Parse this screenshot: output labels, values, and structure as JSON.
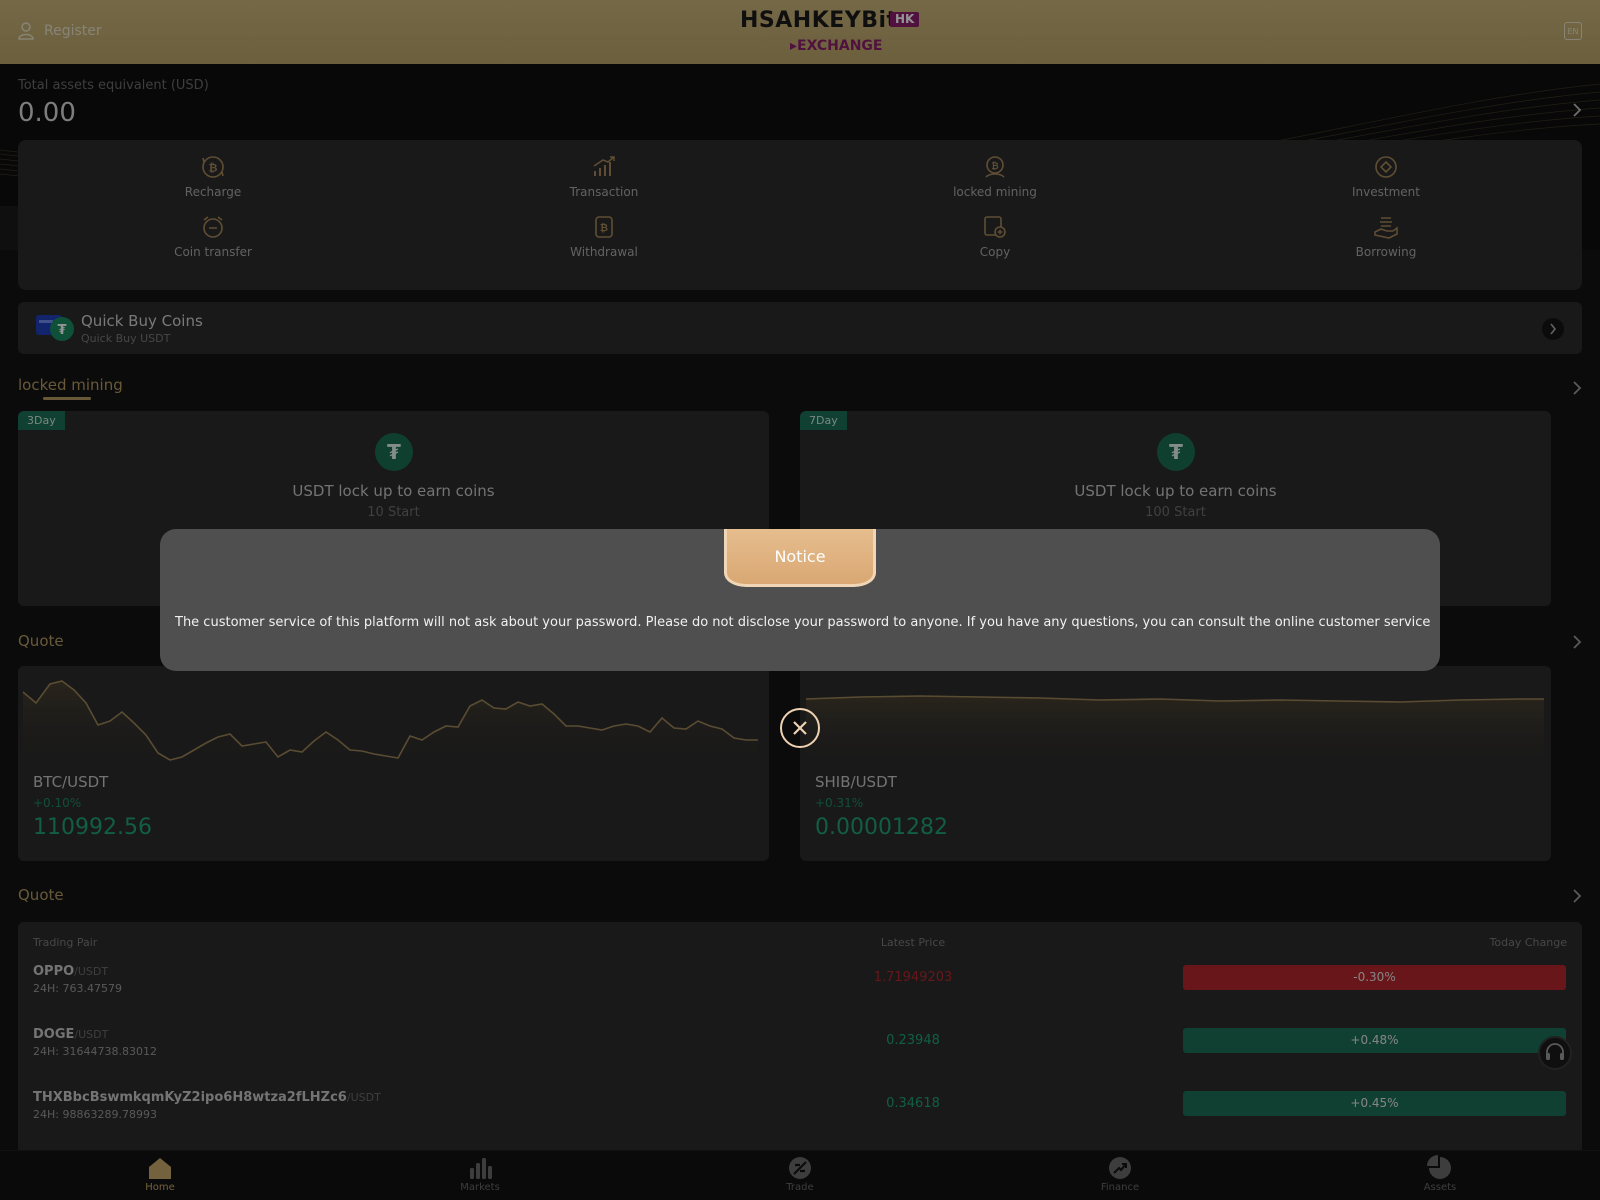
{
  "header": {
    "register_label": "Register",
    "logo_main": "HSAHKEYBit",
    "logo_badge": "HK",
    "logo_sub": "EXCHANGE",
    "lang_label": "EN"
  },
  "assets": {
    "label": "Total assets equivalent  (USD)",
    "amount": "0.00"
  },
  "shortcuts": [
    {
      "label": "Recharge",
      "icon": "recharge-icon"
    },
    {
      "label": "Transaction",
      "icon": "transaction-icon"
    },
    {
      "label": "locked mining",
      "icon": "locked-mining-icon"
    },
    {
      "label": "Investment",
      "icon": "investment-icon"
    },
    {
      "label": "Coin transfer",
      "icon": "coin-transfer-icon"
    },
    {
      "label": "Withdrawal",
      "icon": "withdrawal-icon"
    },
    {
      "label": "Copy",
      "icon": "copy-icon"
    },
    {
      "label": "Borrowing",
      "icon": "borrowing-icon"
    }
  ],
  "quick_buy": {
    "title": "Quick Buy Coins",
    "subtitle": "Quick Buy USDT"
  },
  "mining": {
    "title": "locked mining",
    "cards": [
      {
        "tag": "3Day",
        "title": "USDT lock up to earn coins",
        "subtitle": "10 Start"
      },
      {
        "tag": "7Day",
        "title": "USDT lock up to earn coins",
        "subtitle": "100 Start"
      }
    ]
  },
  "quote_charts": {
    "title": "Quote",
    "cards": [
      {
        "pair": "BTC/USDT",
        "change": "+0.10%",
        "price": "110992.56"
      },
      {
        "pair": "SHIB/USDT",
        "change": "+0.31%",
        "price": "0.00001282"
      }
    ]
  },
  "market": {
    "title": "Quote",
    "headers": {
      "pair": "Trading Pair",
      "price": "Latest Price",
      "change": "Today Change"
    },
    "rows": [
      {
        "base": "OPPO",
        "quote": "/USDT",
        "volume": "24H: 763.47579",
        "price": "1.71949203",
        "change": "-0.30%",
        "direction": "down"
      },
      {
        "base": "DOGE",
        "quote": "/USDT",
        "volume": "24H: 31644738.83012",
        "price": "0.23948",
        "change": "+0.48%",
        "direction": "up"
      },
      {
        "base": "THXBbcBswmkqmKyZ2ipo6H8wtza2fLHZc6",
        "quote": "/USDT",
        "volume": "24H: 98863289.78993",
        "price": "0.34618",
        "change": "+0.45%",
        "direction": "up"
      }
    ]
  },
  "nav": [
    {
      "label": "Home",
      "icon": "home-icon",
      "active": true
    },
    {
      "label": "Markets",
      "icon": "markets-icon",
      "active": false
    },
    {
      "label": "Trade",
      "icon": "trade-icon",
      "active": false
    },
    {
      "label": "Finance",
      "icon": "finance-icon",
      "active": false
    },
    {
      "label": "Assets",
      "icon": "assets-icon",
      "active": false
    }
  ],
  "notice": {
    "title": "Notice",
    "message": "The customer service of this platform will not ask about your password. Please do not disclose your password to anyone. If you have any questions, you can consult the online customer service"
  },
  "colors": {
    "accent_gold": "#b49a62",
    "up_green": "#1fa378",
    "down_red": "#b4262d",
    "pill_green": "#1d6f55",
    "pill_red": "#b4262d"
  }
}
